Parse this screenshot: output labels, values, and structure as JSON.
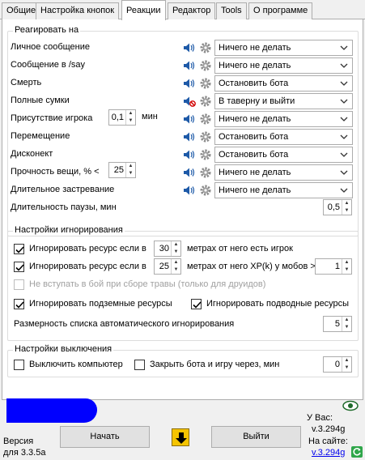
{
  "tabs": [
    "Общие",
    "Настройка кнопок",
    "Реакции",
    "Редактор",
    "Tools",
    "О программе"
  ],
  "react": {
    "title": "Реагировать на",
    "rows": [
      {
        "label": "Личное сообщение",
        "action": "Ничего не делать"
      },
      {
        "label": "Сообщение в /say",
        "action": "Ничего не делать"
      },
      {
        "label": "Смерть",
        "action": "Остановить бота"
      },
      {
        "label": "Полные сумки",
        "action": "В таверну и выйти",
        "muted": true
      },
      {
        "label": "Присутствие игрока",
        "action": "Ничего не делать"
      },
      {
        "label": "Перемещение",
        "action": "Остановить бота"
      },
      {
        "label": "Дисконект",
        "action": "Остановить бота"
      },
      {
        "label": "Прочность вещи, % <",
        "action": "Ничего не делать"
      },
      {
        "label": "Длительное застревание",
        "action": "Ничего не делать"
      }
    ],
    "player_presence_value": "0,1",
    "player_presence_unit": "мин",
    "durability_value": "25",
    "pause_label": "Длительность паузы, мин",
    "pause_value": "0,5"
  },
  "ignore": {
    "title": "Настройки игнорирования",
    "row1_prefix": "Игнорировать ресурс если в",
    "row1_value": "30",
    "row1_suffix": "метрах от него есть игрок",
    "row2_prefix": "Игнорировать ресурс если в",
    "row2_value": "25",
    "row2_suffix": "метрах от него XP(k) у мобов >",
    "row2_value2": "1",
    "herb_label": "Не вступать в бой при сборе травы (только для друидов)",
    "underground_label": "Игнорировать подземные ресурсы",
    "underwater_label": "Игнорировать подводные ресурсы",
    "list_size_label": "Размерность списка автоматического игнорирования",
    "list_size_value": "5"
  },
  "shutdown": {
    "title": "Настройки выключения",
    "pc_label": "Выключить компьютер",
    "close_label": "Закрыть бота и игру через, мин",
    "close_value": "0"
  },
  "footer": {
    "version_label": "Версия",
    "version_for": "для 3.3.5a",
    "start_label": "Начать",
    "exit_label": "Выйти",
    "you_have_label": "У Вас:",
    "you_have_version": "v.3.294g",
    "site_label": "На сайте:",
    "site_version": "v.3.294g"
  },
  "colors": {
    "accent": "#0000ff",
    "speaker": "#1e5aa8",
    "mute": "#d00000",
    "down_arrow": "#f5c400"
  }
}
